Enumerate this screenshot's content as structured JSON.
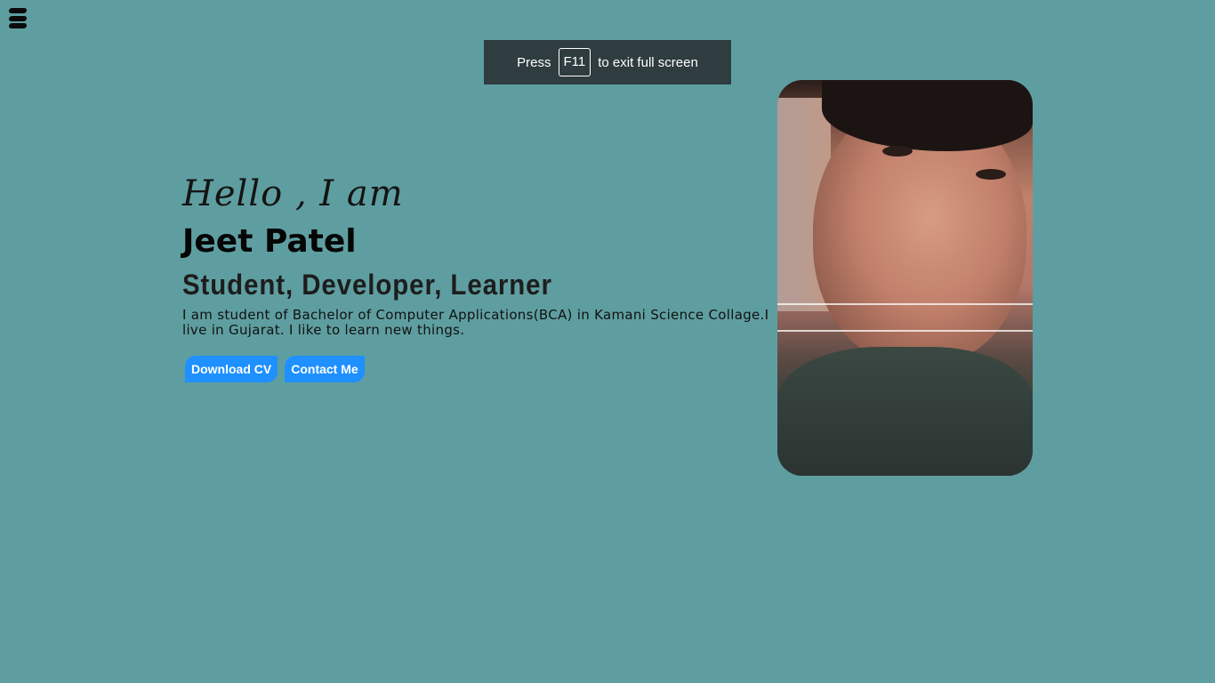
{
  "menu": {
    "icon": "hamburger-menu-icon"
  },
  "fullscreen_notice": {
    "prefix": "Press",
    "key": "F11",
    "suffix": "to exit full screen"
  },
  "hero": {
    "greeting": "Hello , I am",
    "name": "Jeet Patel",
    "roles": "Student, Developer, Learner",
    "bio": "I am student of Bachelor of Computer Applications(BCA) in Kamani Science Collage.I live in Gujarat. I like to learn new things.",
    "buttons": {
      "download_cv": "Download CV",
      "contact_me": "Contact Me"
    }
  },
  "colors": {
    "background": "#5f9ea0",
    "button": "#1e90ff",
    "toast": "#2f3c40"
  }
}
